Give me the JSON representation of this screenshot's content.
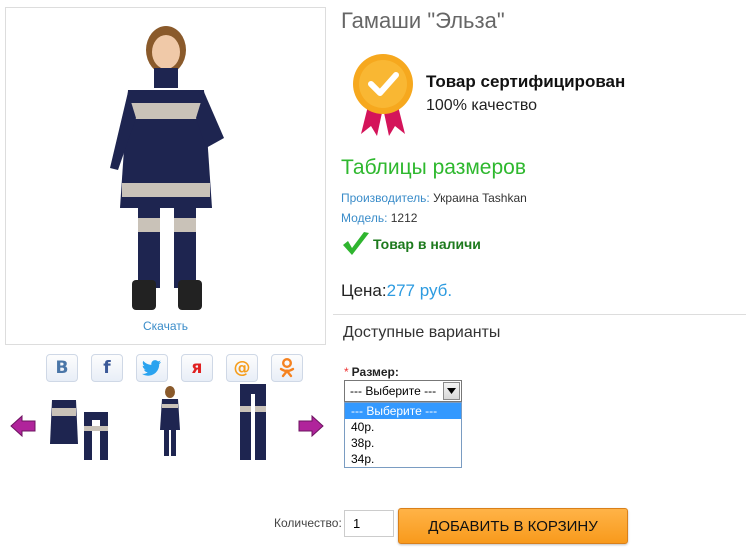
{
  "product": {
    "title": "Гамаши \"Эльза\"",
    "download_label": "Скачать",
    "certified_title": "Товар сертифицирован",
    "certified_sub": "100% качество",
    "size_table_link": "Таблицы размеров",
    "manufacturer_key": "Производитель:",
    "manufacturer_value": " Украина Tashkan",
    "model_key": "Модель:",
    "model_value": " 1212",
    "in_stock": "Товар в наличи",
    "price_label": "Цена:",
    "price_value": "277 руб."
  },
  "share": [
    {
      "icon": "vk-icon",
      "glyph": "В",
      "color": "#4a76a8"
    },
    {
      "icon": "facebook-icon",
      "glyph": "f",
      "color": "#3b5998"
    },
    {
      "icon": "twitter-icon",
      "glyph": "🐦",
      "color": "#2aa3ef"
    },
    {
      "icon": "yaru-icon",
      "glyph": "я",
      "color": "#e02020"
    },
    {
      "icon": "mailru-icon",
      "glyph": "@",
      "color": "#f59d1c"
    },
    {
      "icon": "odnoklassniki-icon",
      "glyph": "ok",
      "color": "#f58220"
    }
  ],
  "options": {
    "heading": "Доступные варианты",
    "size_label": "Размер:",
    "required_mark": "*",
    "selected": "--- Выберите ---",
    "list": [
      "--- Выберите ---",
      "40р.",
      "38р.",
      "34р."
    ]
  },
  "cart": {
    "qty_label": "Количество:",
    "qty_value": "1",
    "add_label": "ДОБАВИТЬ В КОРЗИНУ"
  },
  "colors": {
    "accent_green": "#2eb82e",
    "link_blue": "#3a8cc9",
    "price_blue": "#2d9be0",
    "button_orange": "#f89a1c"
  }
}
